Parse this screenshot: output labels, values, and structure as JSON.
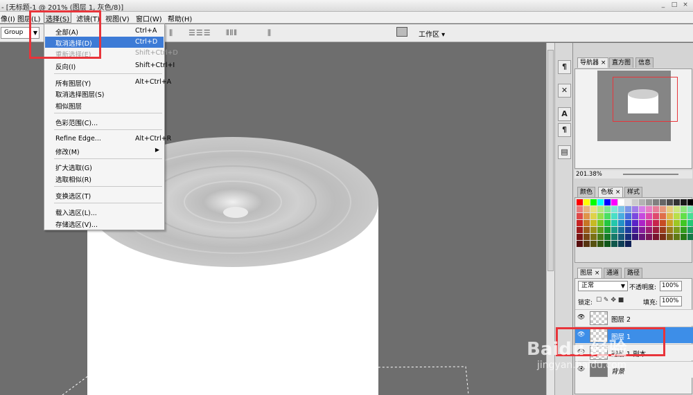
{
  "window": {
    "title": "- [无标题-1 @ 201% (图层 1, 灰色/8)]",
    "buttons": [
      "_",
      "□",
      "×"
    ]
  },
  "menubar": {
    "items": [
      {
        "label": "像(I)"
      },
      {
        "label": "图层(L)"
      },
      {
        "label": "选择(S)"
      },
      {
        "label": "滤镜(T)"
      },
      {
        "label": "视图(V)"
      },
      {
        "label": "窗口(W)"
      },
      {
        "label": "帮助(H)"
      }
    ]
  },
  "options_bar": {
    "auto_select_value": "Group",
    "workspace_label": "工作区 ▾"
  },
  "select_menu": {
    "items": [
      {
        "label": "全部(A)",
        "shortcut": "Ctrl+A"
      },
      {
        "label": "取消选择(D)",
        "shortcut": "Ctrl+D"
      },
      {
        "label": "重新选择(E)",
        "shortcut": "Shift+Ctrl+D"
      },
      {
        "label": "反向(I)",
        "shortcut": "Shift+Ctrl+I"
      },
      {
        "label": "所有图层(Y)",
        "shortcut": "Alt+Ctrl+A"
      },
      {
        "label": "取消选择图层(S)",
        "shortcut": ""
      },
      {
        "label": "相似图层",
        "shortcut": ""
      },
      {
        "label": "色彩范围(C)...",
        "shortcut": ""
      },
      {
        "label": "Refine Edge...",
        "shortcut": "Alt+Ctrl+R"
      },
      {
        "label": "修改(M)",
        "shortcut": ""
      },
      {
        "label": "扩大选取(G)",
        "shortcut": ""
      },
      {
        "label": "选取相似(R)",
        "shortcut": ""
      },
      {
        "label": "变换选区(T)",
        "shortcut": ""
      },
      {
        "label": "载入选区(L)...",
        "shortcut": ""
      },
      {
        "label": "存储选区(V)...",
        "shortcut": ""
      }
    ],
    "selected": "取消选择(D)",
    "disabled": "重新选择(E)"
  },
  "navigator_panel": {
    "tabs": [
      "导航器 ×",
      "直方图",
      "信息"
    ],
    "zoom": "201.38%"
  },
  "swatches_panel": {
    "tabs": [
      "颜色",
      "色板 ×",
      "样式"
    ]
  },
  "layers_panel": {
    "tabs": [
      "图层 ×",
      "通道",
      "路径"
    ],
    "blend_mode": "正常",
    "opacity_label": "不透明度:",
    "opacity": "100%",
    "lock_label": "锁定:",
    "fill_label": "填充:",
    "fill": "100%",
    "layers": [
      {
        "name": "图层 2"
      },
      {
        "name": "图层 1"
      },
      {
        "name": "图层 1 副本"
      },
      {
        "name": "背景"
      }
    ]
  },
  "watermark": {
    "text": "Baidu 经验",
    "url": "jingyan.baidu.com"
  }
}
